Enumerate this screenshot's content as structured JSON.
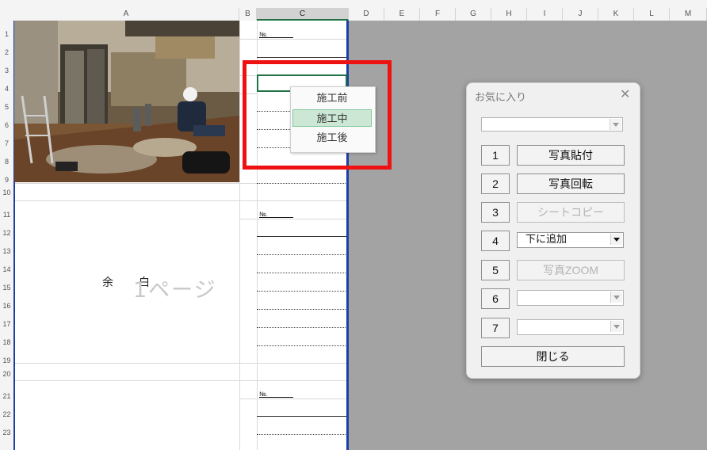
{
  "columns": [
    "A",
    "B",
    "C",
    "D",
    "E",
    "F",
    "G",
    "H",
    "I",
    "J",
    "K",
    "L",
    "M"
  ],
  "rows": [
    "1",
    "2",
    "3",
    "4",
    "5",
    "6",
    "7",
    "8",
    "9",
    "10",
    "11",
    "12",
    "13",
    "14",
    "15",
    "16",
    "17",
    "18",
    "19",
    "20",
    "21",
    "22",
    "23"
  ],
  "sheet": {
    "photo_no_label": "№.",
    "blank_label_1": "余",
    "blank_label_2": "白",
    "page_watermark": "1ページ"
  },
  "popup": {
    "items": [
      "施工前",
      "施工中",
      "施工後"
    ],
    "selected_index": 1
  },
  "dialog": {
    "title": "お気に入り",
    "close_symbol": "✕",
    "top_combo_value": "",
    "buttons": [
      {
        "num": "1",
        "label": "写真貼付",
        "type": "button",
        "enabled": true
      },
      {
        "num": "2",
        "label": "写真回転",
        "type": "button",
        "enabled": true
      },
      {
        "num": "3",
        "label": "シートコピー",
        "type": "button",
        "enabled": false
      },
      {
        "num": "4",
        "label": "下に追加",
        "type": "combo",
        "enabled": true
      },
      {
        "num": "5",
        "label": "写真ZOOM",
        "type": "button",
        "enabled": false
      },
      {
        "num": "6",
        "label": "",
        "type": "combo",
        "enabled": false
      },
      {
        "num": "7",
        "label": "",
        "type": "combo",
        "enabled": false
      }
    ],
    "close_button_label": "閉じる"
  },
  "colors": {
    "selection_border": "#217346",
    "highlight_red": "#ee1111",
    "page_border_blue": "#1b3fa8",
    "popup_selected": "#cce8d4"
  }
}
